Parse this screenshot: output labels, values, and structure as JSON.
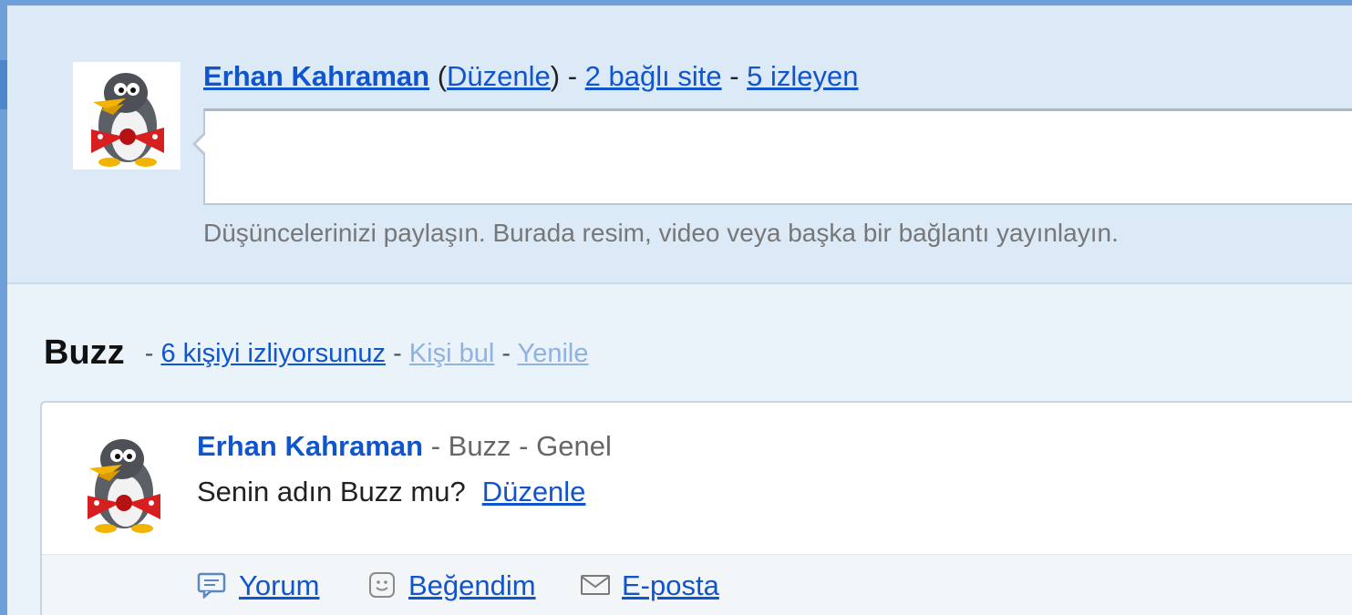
{
  "compose": {
    "user_name": "Erhan Kahraman",
    "edit_label": "Düzenle",
    "paren_open": "(",
    "paren_close": ")",
    "separator": " - ",
    "linked_sites": "2 bağlı site",
    "followers": "5 izleyen",
    "hint": "Düşüncelerinizi paylaşın. Burada resim, video veya başka bir bağlantı yayınlayın.",
    "avatar_icon": "penguin-bowtie-avatar"
  },
  "buzz": {
    "title": "Buzz",
    "separator": " - ",
    "following": "6 kişiyi izliyorsunuz",
    "find_people": "Kişi bul",
    "refresh": "Yenile"
  },
  "post": {
    "author": "Erhan Kahraman",
    "meta_separator": " - ",
    "source": "Buzz",
    "visibility": "Genel",
    "text": "Senin adın Buzz mu?",
    "edit_label": "Düzenle",
    "actions": [
      {
        "label": "Yorum",
        "icon": "comment-icon"
      },
      {
        "label": "Beğendim",
        "icon": "smiley-icon"
      },
      {
        "label": "E-posta",
        "icon": "envelope-icon"
      }
    ]
  },
  "colors": {
    "accent": "#6f9fd8",
    "link": "#1155cc",
    "compose_bg": "#dce9f7"
  }
}
